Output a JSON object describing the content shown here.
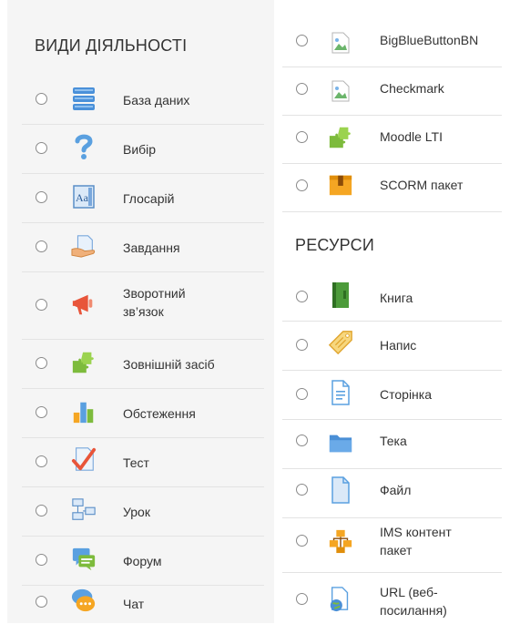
{
  "activities": {
    "title": "ВИДИ ДІЯЛЬНОСТІ",
    "items": [
      {
        "label": "База даних",
        "icon": "database-icon"
      },
      {
        "label": "Вибір",
        "icon": "question-icon"
      },
      {
        "label": "Глосарій",
        "icon": "glossary-icon"
      },
      {
        "label": "Завдання",
        "icon": "assignment-icon"
      },
      {
        "label": "Зворотний зв’язок",
        "icon": "megaphone-icon"
      },
      {
        "label": "Зовнішній засіб",
        "icon": "puzzle-icon"
      },
      {
        "label": "Обстеження",
        "icon": "bar-chart-icon"
      },
      {
        "label": "Тест",
        "icon": "checkmark-icon"
      },
      {
        "label": "Урок",
        "icon": "lesson-icon"
      },
      {
        "label": "Форум",
        "icon": "forum-icon"
      },
      {
        "label": "Чат",
        "icon": "chat-icon"
      }
    ]
  },
  "more_activities": {
    "items": [
      {
        "label": "BigBlueButtonBN",
        "icon": "broken-image-icon"
      },
      {
        "label": "Checkmark",
        "icon": "broken-image-icon"
      },
      {
        "label": "Moodle LTI",
        "icon": "puzzle-icon"
      },
      {
        "label": "SCORM пакет",
        "icon": "scorm-package-icon"
      }
    ]
  },
  "resources": {
    "title": "РЕСУРСИ",
    "items": [
      {
        "label": "Книга",
        "icon": "book-icon"
      },
      {
        "label": "Напис",
        "icon": "label-tag-icon"
      },
      {
        "label": "Сторінка",
        "icon": "page-icon"
      },
      {
        "label": "Тека",
        "icon": "folder-icon"
      },
      {
        "label": "Файл",
        "icon": "file-icon"
      },
      {
        "label": "IMS контент пакет",
        "icon": "ims-package-icon"
      },
      {
        "label": "URL (веб-посилання)",
        "icon": "url-icon"
      }
    ]
  }
}
